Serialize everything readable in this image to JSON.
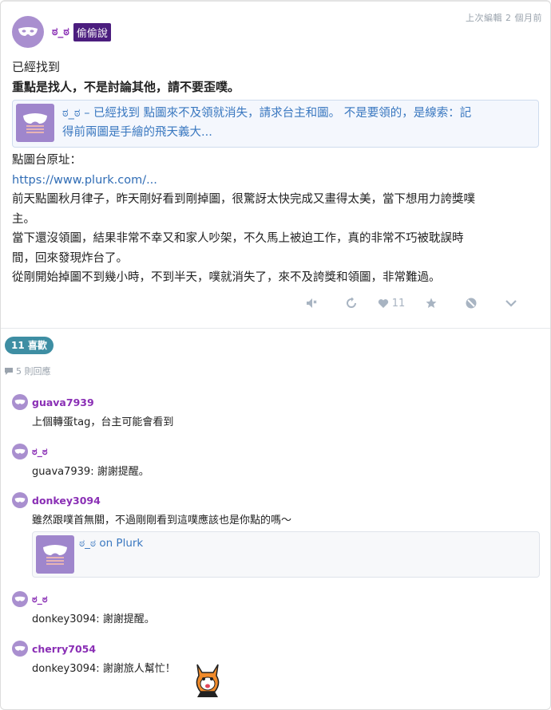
{
  "post": {
    "author": "ಠ_ಠ",
    "qualifier": "偷偷說",
    "edited": "上次編輯 2 個月前",
    "line1": "已經找到",
    "line2": "重點是找人，不是討論其他，請不要歪噗。",
    "quote": {
      "text_line1": "ಠ_ಠ – 已經找到 點圖來不及領就消失，請求台主和圖。 不是要領的，是線索：記",
      "text_line2": "得前兩圖是手繪的飛天義大..."
    },
    "source_label": "點圖台原址：",
    "source_link": "https://www.plurk.com/...",
    "para1_line1": "前天點圖秋月律子，昨天剛好看到剛掉圖，很驚訝太快完成又畫得太美，當下想用力誇獎噗",
    "para1_line2": "主。",
    "para2_line1": "當下還沒領圖，結果非常不幸又和家人吵架，不久馬上被迫工作，真的非常不巧被耽誤時",
    "para2_line2": "間，回來發現炸台了。",
    "para3": "從剛開始掉圖不到幾小時，不到半天，噗就消失了，來不及誇獎和領圖，非常難過。"
  },
  "actions": {
    "like_count": "11"
  },
  "likes_badge": "11 喜歡",
  "reply_count": "5 則回應",
  "responses": [
    {
      "name": "guava7939",
      "text": "上個轉蛋tag，台主可能會看到"
    },
    {
      "name": "ಠ_ಠ",
      "text": "guava7939: 謝謝提醒。"
    },
    {
      "name": "donkey3094",
      "text": "雖然跟噗首無關，不過剛剛看到這噗應該也是你點的嗎～",
      "card": "ಠ_ಠ on Plurk"
    },
    {
      "name": "ಠ_ಠ",
      "text": "donkey3094: 謝謝提醒。"
    },
    {
      "name": "cherry7054",
      "text": "donkey3094: 謝謝旅人幫忙！"
    }
  ],
  "colors": {
    "accent": "#8a2fb5",
    "link": "#2f6cb5",
    "badge": "#3e8ea3",
    "tag_bg": "#4b1d7e"
  },
  "icons": [
    "mask-icon",
    "mute-icon",
    "replurk-icon",
    "heart-icon",
    "star-icon",
    "block-icon",
    "chevron-down-icon",
    "speech-bubble-icon",
    "fox-emoticon"
  ]
}
